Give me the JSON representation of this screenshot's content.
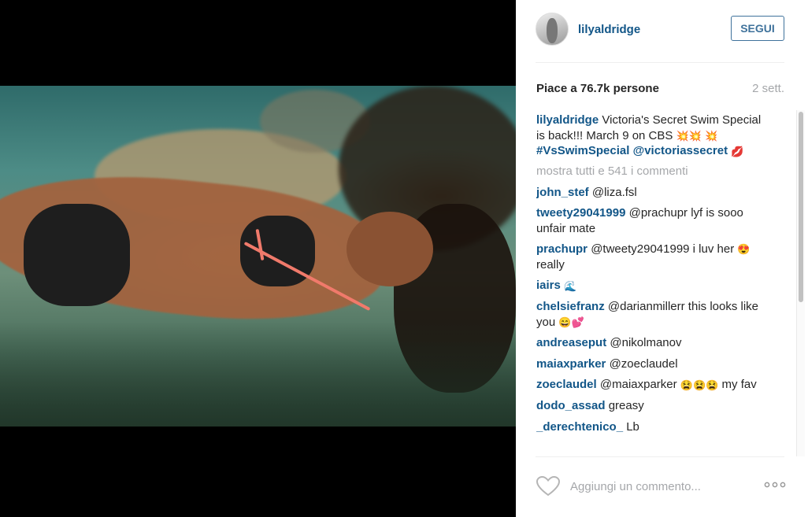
{
  "post": {
    "username": "lilyaldridge",
    "follow_label": "SEGUI",
    "likes_text": "Piace a 76.7k persone",
    "time_ago": "2 sett.",
    "caption_text": "Victoria's Secret Swim Special is back!!! March 9 on CBS",
    "caption_hashtags": "#VsSwimSpecial @victoriassecret",
    "view_all_comments": "mostra tutti e 541 i commenti",
    "add_comment_placeholder": "Aggiungi un commento...",
    "comments": [
      {
        "user": "john_stef",
        "text": "@liza.fsl"
      },
      {
        "user": "tweety29041999",
        "text": "@prachupr lyf is sooo unfair mate"
      },
      {
        "user": "prachupr",
        "text": "@tweety29041999 i luv her",
        "text_after": "really"
      },
      {
        "user": "iairs",
        "text": ""
      },
      {
        "user": "chelsiefranz",
        "text": "@darianmillerr this looks like you"
      },
      {
        "user": "andreaseput",
        "text": "@nikolmanov"
      },
      {
        "user": "maiaxparker",
        "text": "@zoeclaudel"
      },
      {
        "user": "zoeclaudel",
        "text": "@maiaxparker",
        "text_after": "my fav"
      },
      {
        "user": "dodo_assad",
        "text": "greasy"
      },
      {
        "user": "_derechtenico_",
        "text": "Lb"
      }
    ]
  },
  "icons": {
    "emoji_boom": "💥",
    "emoji_kiss": "💋",
    "emoji_heart_eyes": "😍",
    "emoji_wave": "🌊",
    "emoji_smile": "😄",
    "emoji_hearts": "💕",
    "emoji_tired": "😫"
  },
  "colors": {
    "username_blue": "#125688",
    "follow_blue": "#3f729b",
    "muted_gray": "#a5a7aa"
  }
}
